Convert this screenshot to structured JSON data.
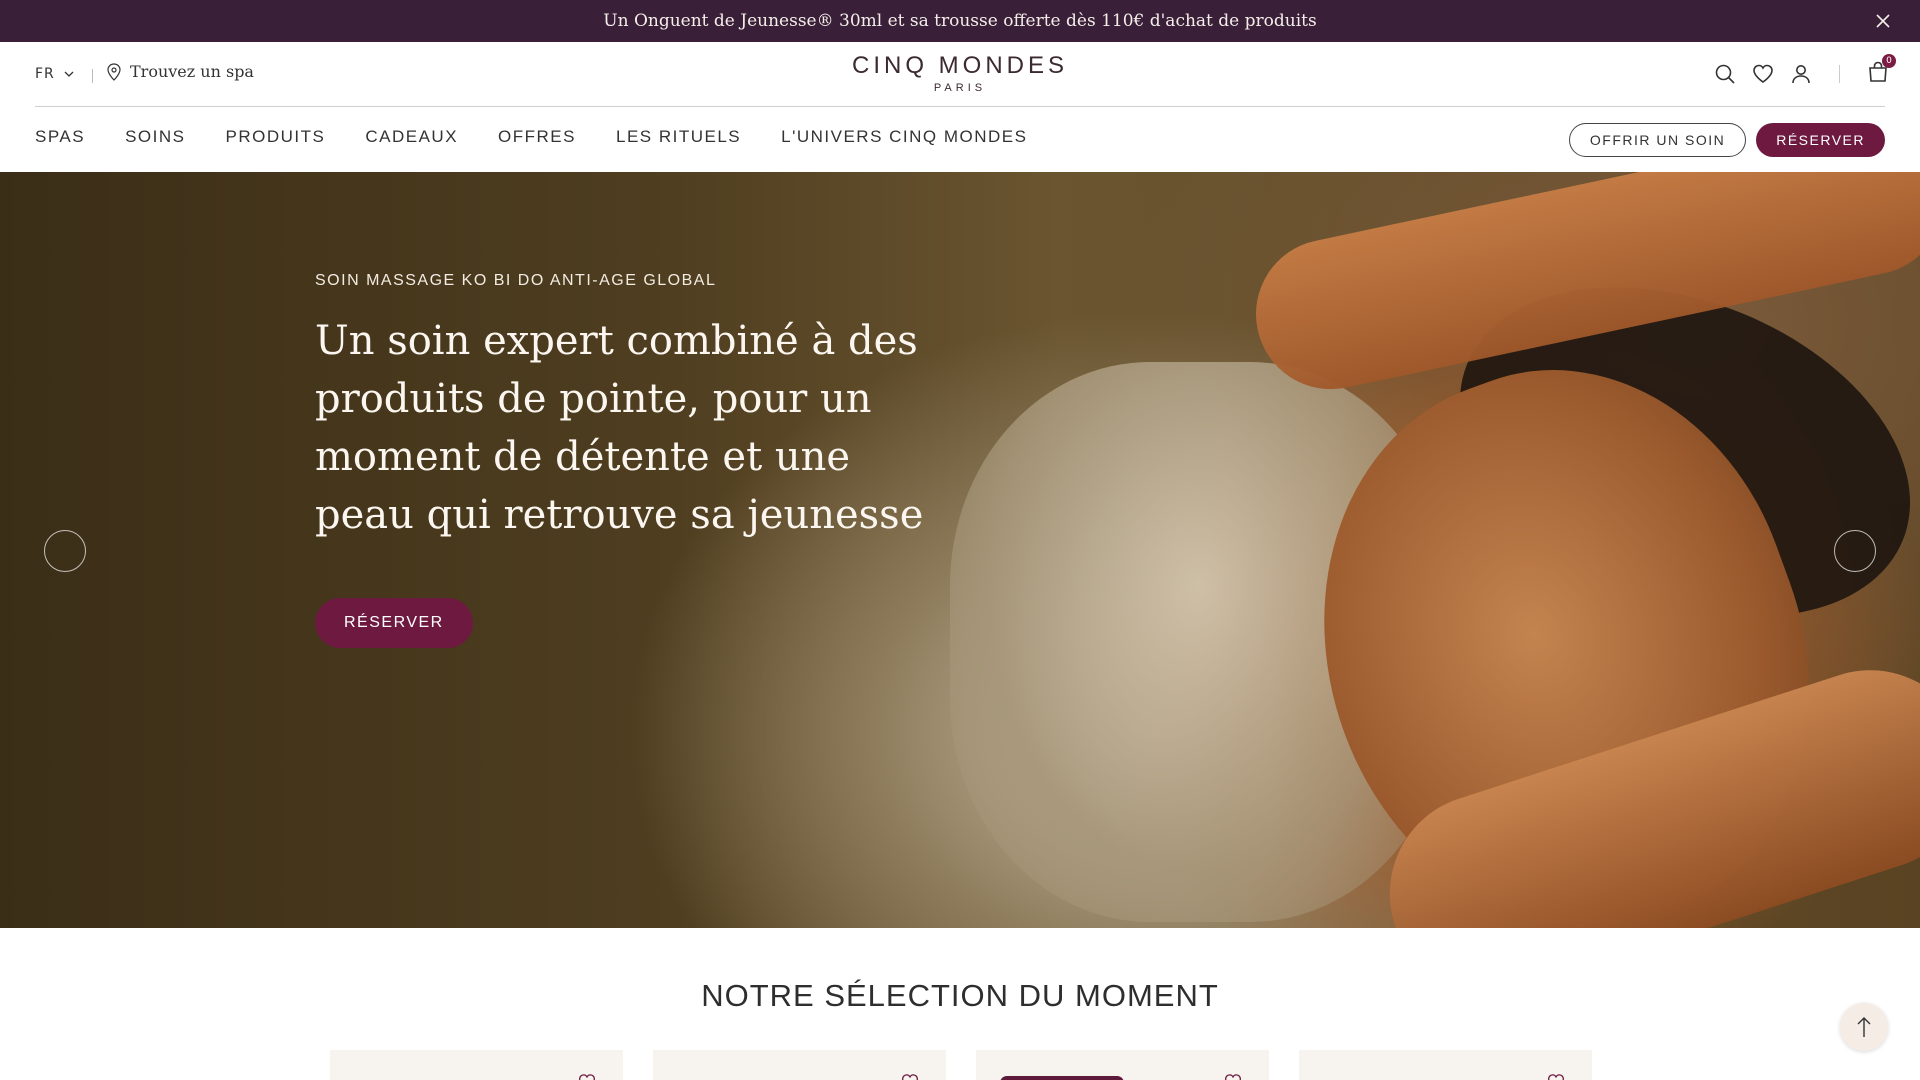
{
  "announcement": {
    "text": "Un Onguent de Jeunesse® 30ml et sa trousse offerte dès 110€ d'achat de produits"
  },
  "utility": {
    "language": "FR",
    "find_spa": "Trouvez un spa",
    "cart_count": "0"
  },
  "logo": {
    "brand": "CINQ MONDES",
    "city": "PARIS"
  },
  "nav": {
    "items": [
      "SPAS",
      "SOINS",
      "PRODUITS",
      "CADEAUX",
      "OFFRES",
      "LES RITUELS",
      "L'UNIVERS CINQ MONDES"
    ],
    "offer_button": "OFFRIR UN SOIN",
    "book_button": "RÉSERVER"
  },
  "hero": {
    "eyebrow": "SOIN MASSAGE KO BI DO ANTI-AGE GLOBAL",
    "headline": "Un soin expert combiné à des produits de pointe, pour un moment de détente et une peau qui retrouve sa jeunesse",
    "cta": "RÉSERVER"
  },
  "selection": {
    "title": "NOTRE SÉLECTION DU MOMENT"
  },
  "colors": {
    "announce_bg": "#3a1f38",
    "accent": "#6e1a40"
  },
  "icons": [
    "close-icon",
    "chevron-down-icon",
    "location-pin-icon",
    "search-icon",
    "heart-icon",
    "user-icon",
    "bag-icon",
    "arrow-up-icon"
  ]
}
